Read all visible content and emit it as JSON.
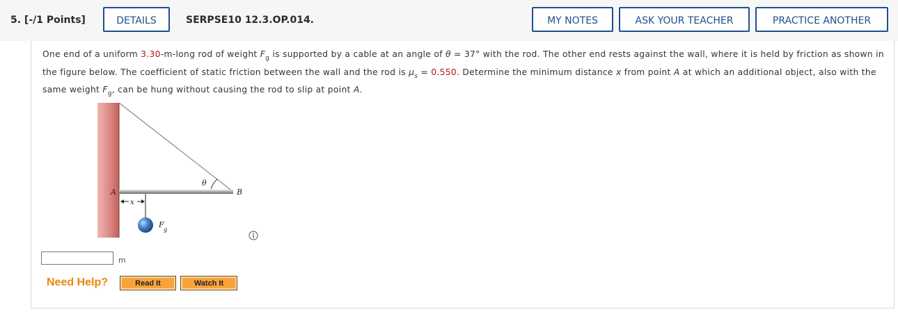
{
  "header": {
    "question_number": "5. [-/1 Points]",
    "details_label": "DETAILS",
    "question_ref": "SERPSE10 12.3.OP.014.",
    "my_notes_label": "MY NOTES",
    "ask_teacher_label": "ASK YOUR TEACHER",
    "practice_another_label": "PRACTICE ANOTHER"
  },
  "question": {
    "t1": "One end of a uniform ",
    "rod_length": "3.30",
    "t2": "-m-long rod of weight ",
    "F": "F",
    "g": "g",
    "t3": " is supported by a cable at an angle of ",
    "theta": "θ",
    "angle": " = 37° with the rod. The other end rests against the wall, where it is held by friction as shown in the figure below. The coefficient of static friction between the wall and the rod is ",
    "mu": "μ",
    "s": "s",
    "eq": " = ",
    "mu_value": "0.550",
    "t4": ". Determine the minimum distance ",
    "x": "x",
    "t5": " from point ",
    "A": "A",
    "t6": " at which an additional object, also with the same weight ",
    "t7": ", can be hung without causing the rod to slip at point ",
    "t8": "."
  },
  "figure": {
    "label_A": "A",
    "label_B": "B",
    "label_x": "x",
    "label_theta": "θ",
    "label_F": "F",
    "label_g": "g"
  },
  "answer": {
    "value": "",
    "unit": "m"
  },
  "help": {
    "label": "Need Help?",
    "read_it": "Read It",
    "watch_it": "Watch It"
  },
  "colors": {
    "button_border": "#1f4f8c",
    "red_value": "#b4131a",
    "wall": "#d98580",
    "help_orange": "#e8870c",
    "ball": "#3f7fc4"
  },
  "icons": [
    "info-icon",
    "left-arrow-icon",
    "right-arrow-icon"
  ]
}
